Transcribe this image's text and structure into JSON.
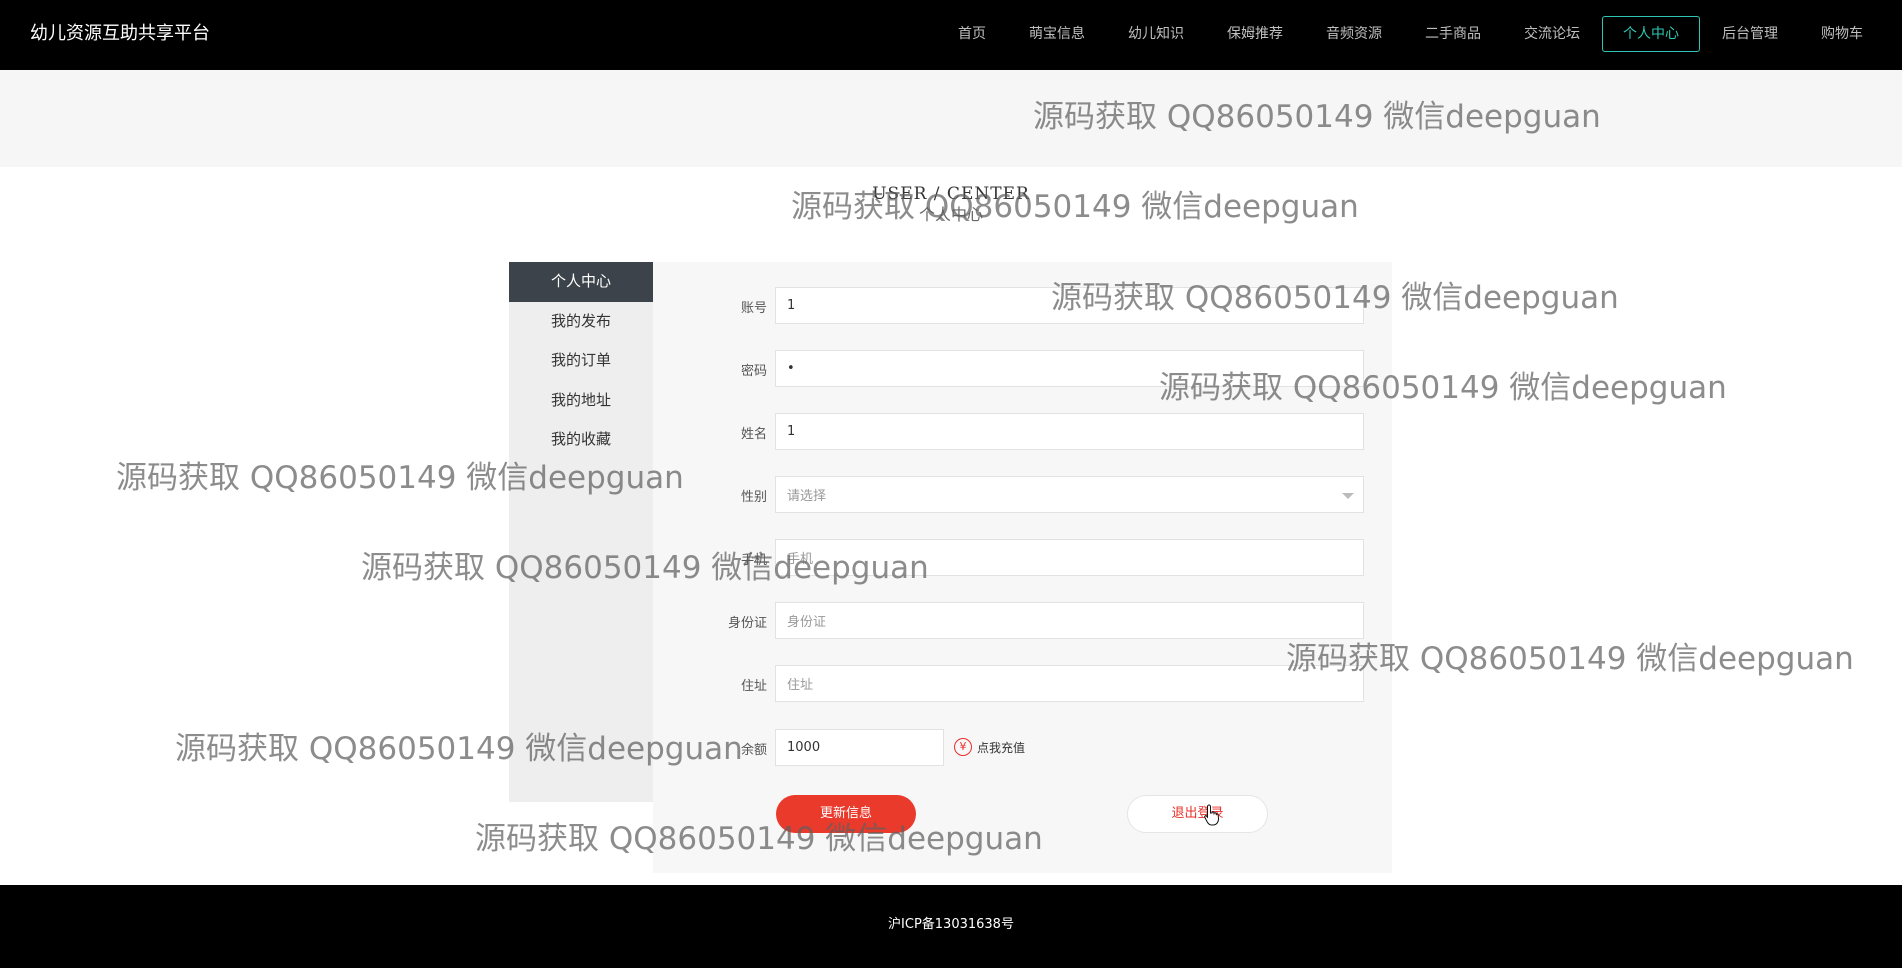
{
  "header": {
    "brand": "幼儿资源互助共享平台",
    "nav": [
      "首页",
      "萌宝信息",
      "幼儿知识",
      "保姆推荐",
      "音频资源",
      "二手商品",
      "交流论坛",
      "个人中心",
      "后台管理",
      "购物车"
    ],
    "active_nav": "个人中心"
  },
  "section": {
    "title_en": "USER / CENTER",
    "title_cn": "个人中心"
  },
  "sidebar": {
    "items": [
      "个人中心",
      "我的发布",
      "我的订单",
      "我的地址",
      "我的收藏"
    ],
    "active": "个人中心"
  },
  "form": {
    "account": {
      "label": "账号",
      "value": "1"
    },
    "password": {
      "label": "密码",
      "value": "•"
    },
    "name": {
      "label": "姓名",
      "value": "1"
    },
    "gender": {
      "label": "性别",
      "placeholder": "请选择"
    },
    "phone": {
      "label": "手机",
      "placeholder": "手机"
    },
    "id_card": {
      "label": "身份证",
      "placeholder": "身份证"
    },
    "address": {
      "label": "住址",
      "placeholder": "住址"
    },
    "balance": {
      "label": "余额",
      "value": "1000"
    },
    "recharge_label": "点我充值",
    "recharge_icon": "¥",
    "update_button": "更新信息",
    "logout_button": "退出登录"
  },
  "footer": {
    "icp": "沪ICP备13031638号"
  },
  "watermark": {
    "text": "源码获取 QQ86050149 微信deepguan"
  },
  "colors": {
    "accent": "#2ec7b4",
    "primary_red": "#ea3a2c",
    "header_bg": "#000000"
  }
}
